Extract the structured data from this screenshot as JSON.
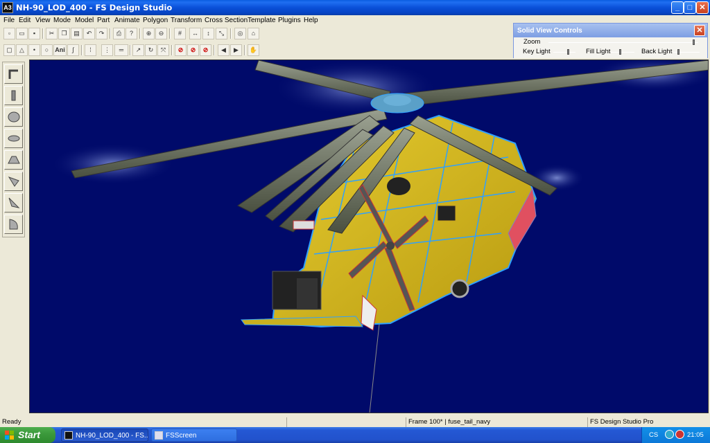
{
  "window": {
    "title": "NH-90_LOD_400 - FS Design Studio",
    "app_icon_text": "A3",
    "minimize": "_",
    "maximize": "□",
    "close": "✕"
  },
  "menu": [
    "File",
    "Edit",
    "View",
    "Mode",
    "Model",
    "Part",
    "Animate",
    "Polygon",
    "Transform",
    "Cross Section",
    "Template",
    "Plugins",
    "Help"
  ],
  "toolbar": {
    "ani_label": "Ani"
  },
  "solid_view": {
    "title": "Solid View Controls",
    "close": "✕",
    "zoom_label": "Zoom",
    "key_light_label": "Key Light",
    "fill_light_label": "Fill Light",
    "back_light_label": "Back Light"
  },
  "status": {
    "ready": "Ready",
    "frame": "Frame 100* | fuse_tail_navy",
    "product": "FS Design Studio Pro"
  },
  "taskbar": {
    "start": "Start",
    "tasks": [
      "NH-90_LOD_400 - FS...",
      "FSScreen"
    ],
    "lang": "CS",
    "clock": "21:05"
  },
  "colors": {
    "viewport_bg": "#000a6a",
    "fuselage": "#d4b820",
    "wire": "#2ea0ff",
    "rotor": "#7a8070"
  }
}
